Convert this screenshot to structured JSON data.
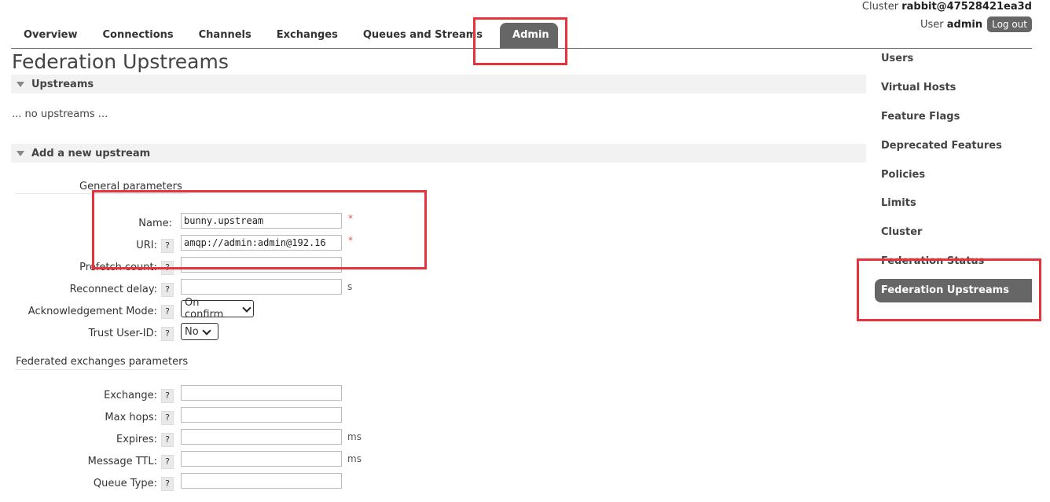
{
  "header": {
    "cluster_label": "Cluster",
    "cluster_name": "rabbit@47528421ea3d",
    "user_label": "User",
    "user_name": "admin",
    "logout_label": "Log out"
  },
  "tabs": [
    {
      "label": "Overview"
    },
    {
      "label": "Connections"
    },
    {
      "label": "Channels"
    },
    {
      "label": "Exchanges"
    },
    {
      "label": "Queues and Streams"
    },
    {
      "label": "Admin",
      "active": true
    }
  ],
  "page_title": "Federation Upstreams",
  "upstreams_section": {
    "title": "Upstreams",
    "empty_text": "... no upstreams ..."
  },
  "add_section": {
    "title": "Add a new upstream",
    "general_heading": "General parameters",
    "federated_heading": "Federated exchanges parameters",
    "fields": {
      "name": {
        "label": "Name:",
        "value": "bunny.upstream",
        "required": "*"
      },
      "uri": {
        "label": "URI:",
        "help": "?",
        "value": "amqp://admin:admin@192.16",
        "required": "*"
      },
      "prefetch": {
        "label": "Prefetch count:",
        "help": "?",
        "value": ""
      },
      "reconnect": {
        "label": "Reconnect delay:",
        "help": "?",
        "value": "",
        "unit": "s"
      },
      "ack_mode": {
        "label": "Acknowledgement Mode:",
        "help": "?",
        "selected": "On confirm"
      },
      "trust_user": {
        "label": "Trust User-ID:",
        "help": "?",
        "selected": "No"
      },
      "exchange": {
        "label": "Exchange:",
        "help": "?",
        "value": ""
      },
      "max_hops": {
        "label": "Max hops:",
        "help": "?",
        "value": ""
      },
      "expires": {
        "label": "Expires:",
        "help": "?",
        "value": "",
        "unit": "ms"
      },
      "message_ttl": {
        "label": "Message TTL:",
        "help": "?",
        "value": "",
        "unit": "ms"
      },
      "queue_type": {
        "label": "Queue Type:",
        "help": "?",
        "value": ""
      }
    }
  },
  "sidebar": {
    "items": [
      {
        "label": "Users"
      },
      {
        "label": "Virtual Hosts"
      },
      {
        "label": "Feature Flags"
      },
      {
        "label": "Deprecated Features"
      },
      {
        "label": "Policies"
      },
      {
        "label": "Limits"
      },
      {
        "label": "Cluster"
      },
      {
        "label": "Federation Status"
      },
      {
        "label": "Federation Upstreams",
        "active": true
      }
    ]
  },
  "colors": {
    "accent": "#666666",
    "highlight_box": "#e8323c",
    "required": "#e0554a"
  }
}
